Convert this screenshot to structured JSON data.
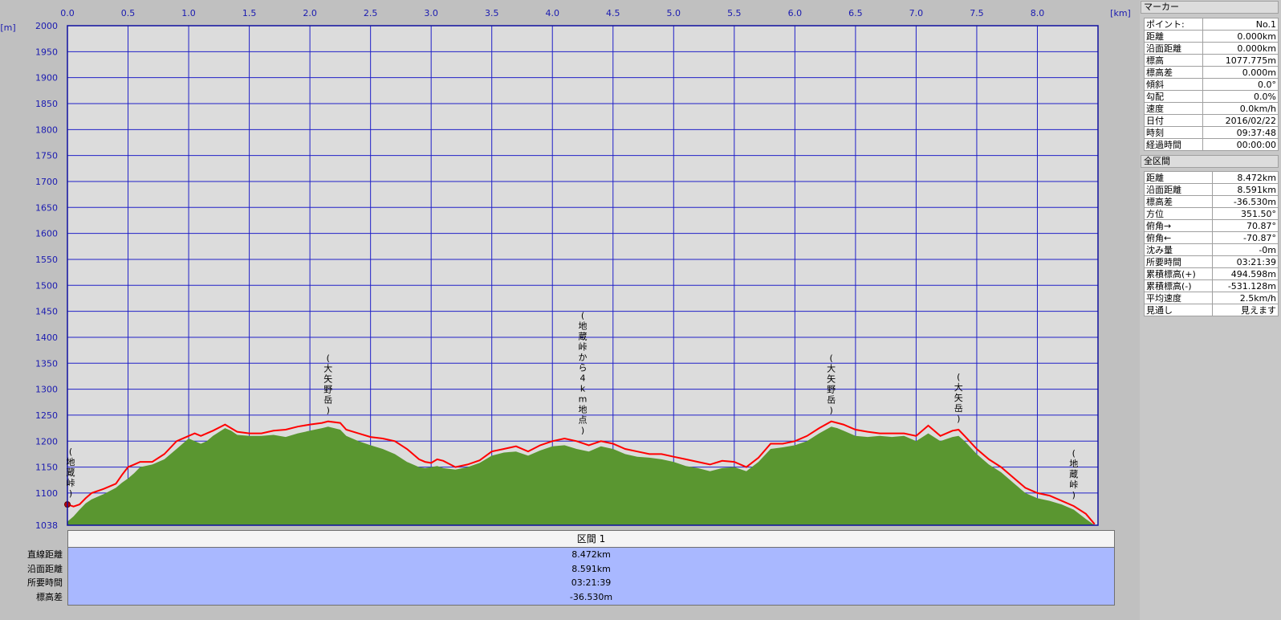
{
  "chart_data": {
    "type": "area",
    "x_unit_label": "[km]",
    "y_unit_label": "[m]",
    "xlim": [
      0,
      8.472
    ],
    "ylim": [
      1038,
      2000
    ],
    "x_ticks": [
      "0.0",
      "0.5",
      "1.0",
      "1.5",
      "2.0",
      "2.5",
      "3.0",
      "3.5",
      "4.0",
      "4.5",
      "5.0",
      "5.5",
      "6.0",
      "6.5",
      "7.0",
      "7.5",
      "8.0"
    ],
    "y_ticks": [
      "2000",
      "1950",
      "1900",
      "1850",
      "1800",
      "1750",
      "1700",
      "1650",
      "1600",
      "1550",
      "1500",
      "1450",
      "1400",
      "1350",
      "1300",
      "1250",
      "1200",
      "1150",
      "1100",
      "1038"
    ],
    "colors": {
      "terrain": "#5a9630",
      "route": "#ff0000",
      "grid": "#2020c8",
      "plot_bg": "#dcdcdc"
    },
    "route": {
      "x": [
        0.0,
        0.05,
        0.1,
        0.15,
        0.2,
        0.3,
        0.4,
        0.45,
        0.5,
        0.55,
        0.6,
        0.7,
        0.8,
        0.9,
        1.0,
        1.05,
        1.1,
        1.15,
        1.2,
        1.3,
        1.35,
        1.4,
        1.5,
        1.6,
        1.7,
        1.8,
        1.9,
        2.0,
        2.1,
        2.15,
        2.25,
        2.3,
        2.4,
        2.5,
        2.6,
        2.7,
        2.8,
        2.9,
        2.95,
        3.0,
        3.05,
        3.1,
        3.2,
        3.3,
        3.4,
        3.5,
        3.6,
        3.7,
        3.8,
        3.9,
        4.0,
        4.1,
        4.2,
        4.3,
        4.4,
        4.5,
        4.6,
        4.7,
        4.8,
        4.9,
        5.0,
        5.1,
        5.2,
        5.3,
        5.4,
        5.5,
        5.6,
        5.7,
        5.8,
        5.9,
        6.0,
        6.1,
        6.2,
        6.3,
        6.35,
        6.4,
        6.5,
        6.6,
        6.7,
        6.8,
        6.9,
        7.0,
        7.1,
        7.2,
        7.3,
        7.35,
        7.4,
        7.5,
        7.6,
        7.7,
        7.8,
        7.9,
        8.0,
        8.1,
        8.2,
        8.3,
        8.4,
        8.472
      ],
      "y": [
        1078,
        1074,
        1078,
        1090,
        1100,
        1108,
        1118,
        1135,
        1150,
        1155,
        1160,
        1160,
        1175,
        1200,
        1210,
        1215,
        1210,
        1215,
        1220,
        1232,
        1225,
        1218,
        1215,
        1215,
        1220,
        1222,
        1228,
        1232,
        1235,
        1238,
        1235,
        1222,
        1215,
        1208,
        1205,
        1200,
        1185,
        1165,
        1160,
        1158,
        1165,
        1162,
        1150,
        1155,
        1163,
        1180,
        1185,
        1190,
        1180,
        1192,
        1200,
        1205,
        1200,
        1192,
        1200,
        1195,
        1185,
        1180,
        1175,
        1175,
        1170,
        1165,
        1160,
        1155,
        1162,
        1160,
        1150,
        1168,
        1195,
        1195,
        1200,
        1210,
        1225,
        1238,
        1235,
        1232,
        1222,
        1218,
        1215,
        1215,
        1215,
        1210,
        1230,
        1210,
        1220,
        1222,
        1210,
        1185,
        1165,
        1150,
        1130,
        1110,
        1100,
        1095,
        1085,
        1075,
        1060,
        1040
      ]
    },
    "terrain": {
      "x": [
        0.0,
        0.05,
        0.1,
        0.15,
        0.2,
        0.3,
        0.4,
        0.45,
        0.5,
        0.55,
        0.6,
        0.7,
        0.8,
        0.9,
        1.0,
        1.05,
        1.1,
        1.15,
        1.2,
        1.3,
        1.35,
        1.4,
        1.5,
        1.6,
        1.7,
        1.8,
        1.9,
        2.0,
        2.1,
        2.15,
        2.25,
        2.3,
        2.4,
        2.5,
        2.6,
        2.7,
        2.8,
        2.9,
        2.95,
        3.0,
        3.05,
        3.1,
        3.2,
        3.3,
        3.4,
        3.5,
        3.6,
        3.7,
        3.8,
        3.9,
        4.0,
        4.1,
        4.2,
        4.3,
        4.4,
        4.5,
        4.6,
        4.7,
        4.8,
        4.9,
        5.0,
        5.1,
        5.2,
        5.3,
        5.4,
        5.5,
        5.6,
        5.7,
        5.8,
        5.9,
        6.0,
        6.1,
        6.2,
        6.3,
        6.35,
        6.4,
        6.5,
        6.6,
        6.7,
        6.8,
        6.9,
        7.0,
        7.1,
        7.2,
        7.3,
        7.35,
        7.4,
        7.5,
        7.6,
        7.7,
        7.8,
        7.9,
        8.0,
        8.1,
        8.2,
        8.3,
        8.4,
        8.472
      ],
      "y": [
        1045,
        1055,
        1068,
        1080,
        1088,
        1098,
        1110,
        1120,
        1128,
        1138,
        1150,
        1155,
        1165,
        1185,
        1205,
        1200,
        1195,
        1200,
        1210,
        1225,
        1220,
        1212,
        1210,
        1210,
        1212,
        1208,
        1215,
        1220,
        1225,
        1228,
        1222,
        1210,
        1200,
        1192,
        1185,
        1175,
        1160,
        1150,
        1148,
        1150,
        1152,
        1148,
        1145,
        1150,
        1158,
        1172,
        1178,
        1180,
        1172,
        1182,
        1190,
        1192,
        1185,
        1180,
        1190,
        1185,
        1175,
        1170,
        1168,
        1165,
        1160,
        1152,
        1148,
        1142,
        1148,
        1150,
        1142,
        1160,
        1185,
        1188,
        1192,
        1200,
        1215,
        1228,
        1225,
        1220,
        1210,
        1208,
        1210,
        1208,
        1210,
        1200,
        1215,
        1200,
        1208,
        1210,
        1200,
        1175,
        1155,
        1140,
        1120,
        1100,
        1090,
        1085,
        1078,
        1068,
        1050,
        1038
      ]
    },
    "annotations": [
      {
        "x": 0.0,
        "label": "(地蔵峠)"
      },
      {
        "x": 2.15,
        "label": "(大矢野岳)"
      },
      {
        "x": 4.25,
        "label": "(地蔵峠から4km地点)"
      },
      {
        "x": 6.3,
        "label": "(大矢野岳)"
      },
      {
        "x": 7.35,
        "label": "(大矢岳)"
      },
      {
        "x": 8.3,
        "label": "(地蔵峠)"
      }
    ],
    "grid": true
  },
  "marker_panel": {
    "title": "マーカー",
    "rows": [
      {
        "label": "ポイント:",
        "value": "No.1"
      },
      {
        "label": "距離",
        "value": "0.000km"
      },
      {
        "label": "沿面距離",
        "value": "0.000km"
      },
      {
        "label": "標高",
        "value": "1077.775m"
      },
      {
        "label": "標高差",
        "value": "0.000m"
      },
      {
        "label": "傾斜",
        "value": "0.0°"
      },
      {
        "label": "勾配",
        "value": "0.0%"
      },
      {
        "label": "速度",
        "value": "0.0km/h"
      },
      {
        "label": "日付",
        "value": "2016/02/22"
      },
      {
        "label": "時刻",
        "value": "09:37:48"
      },
      {
        "label": "経過時間",
        "value": "00:00:00"
      }
    ]
  },
  "total_panel": {
    "title": "全区間",
    "rows": [
      {
        "label": "距離",
        "value": "8.472km"
      },
      {
        "label": "沿面距離",
        "value": "8.591km"
      },
      {
        "label": "標高差",
        "value": "-36.530m"
      },
      {
        "label": "方位",
        "value": "351.50°"
      },
      {
        "label": "俯角→",
        "value": "70.87°"
      },
      {
        "label": "俯角←",
        "value": "-70.87°"
      },
      {
        "label": "沈み量",
        "value": "-0m"
      },
      {
        "label": "所要時間",
        "value": "03:21:39"
      },
      {
        "label": "累積標高(+)",
        "value": "494.598m"
      },
      {
        "label": "累積標高(-)",
        "value": "-531.128m"
      },
      {
        "label": "平均速度",
        "value": "2.5km/h"
      },
      {
        "label": "見通し",
        "value": "見えます"
      }
    ]
  },
  "segment_table": {
    "header": "区間 1",
    "rows": [
      {
        "label": "直線距離",
        "value": "8.472km"
      },
      {
        "label": "沿面距離",
        "value": "8.591km"
      },
      {
        "label": "所要時間",
        "value": "03:21:39"
      },
      {
        "label": "標高差",
        "value": "-36.530m"
      }
    ]
  }
}
